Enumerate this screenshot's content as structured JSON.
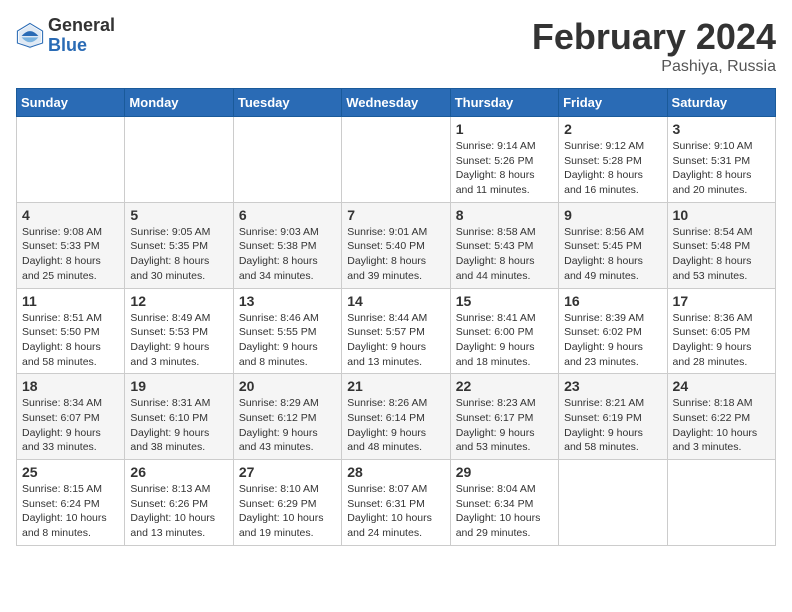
{
  "header": {
    "logo_general": "General",
    "logo_blue": "Blue",
    "title": "February 2024",
    "location": "Pashiya, Russia"
  },
  "calendar": {
    "days_of_week": [
      "Sunday",
      "Monday",
      "Tuesday",
      "Wednesday",
      "Thursday",
      "Friday",
      "Saturday"
    ],
    "weeks": [
      [
        {
          "day": "",
          "info": ""
        },
        {
          "day": "",
          "info": ""
        },
        {
          "day": "",
          "info": ""
        },
        {
          "day": "",
          "info": ""
        },
        {
          "day": "1",
          "info": "Sunrise: 9:14 AM\nSunset: 5:26 PM\nDaylight: 8 hours and 11 minutes."
        },
        {
          "day": "2",
          "info": "Sunrise: 9:12 AM\nSunset: 5:28 PM\nDaylight: 8 hours and 16 minutes."
        },
        {
          "day": "3",
          "info": "Sunrise: 9:10 AM\nSunset: 5:31 PM\nDaylight: 8 hours and 20 minutes."
        }
      ],
      [
        {
          "day": "4",
          "info": "Sunrise: 9:08 AM\nSunset: 5:33 PM\nDaylight: 8 hours and 25 minutes."
        },
        {
          "day": "5",
          "info": "Sunrise: 9:05 AM\nSunset: 5:35 PM\nDaylight: 8 hours and 30 minutes."
        },
        {
          "day": "6",
          "info": "Sunrise: 9:03 AM\nSunset: 5:38 PM\nDaylight: 8 hours and 34 minutes."
        },
        {
          "day": "7",
          "info": "Sunrise: 9:01 AM\nSunset: 5:40 PM\nDaylight: 8 hours and 39 minutes."
        },
        {
          "day": "8",
          "info": "Sunrise: 8:58 AM\nSunset: 5:43 PM\nDaylight: 8 hours and 44 minutes."
        },
        {
          "day": "9",
          "info": "Sunrise: 8:56 AM\nSunset: 5:45 PM\nDaylight: 8 hours and 49 minutes."
        },
        {
          "day": "10",
          "info": "Sunrise: 8:54 AM\nSunset: 5:48 PM\nDaylight: 8 hours and 53 minutes."
        }
      ],
      [
        {
          "day": "11",
          "info": "Sunrise: 8:51 AM\nSunset: 5:50 PM\nDaylight: 8 hours and 58 minutes."
        },
        {
          "day": "12",
          "info": "Sunrise: 8:49 AM\nSunset: 5:53 PM\nDaylight: 9 hours and 3 minutes."
        },
        {
          "day": "13",
          "info": "Sunrise: 8:46 AM\nSunset: 5:55 PM\nDaylight: 9 hours and 8 minutes."
        },
        {
          "day": "14",
          "info": "Sunrise: 8:44 AM\nSunset: 5:57 PM\nDaylight: 9 hours and 13 minutes."
        },
        {
          "day": "15",
          "info": "Sunrise: 8:41 AM\nSunset: 6:00 PM\nDaylight: 9 hours and 18 minutes."
        },
        {
          "day": "16",
          "info": "Sunrise: 8:39 AM\nSunset: 6:02 PM\nDaylight: 9 hours and 23 minutes."
        },
        {
          "day": "17",
          "info": "Sunrise: 8:36 AM\nSunset: 6:05 PM\nDaylight: 9 hours and 28 minutes."
        }
      ],
      [
        {
          "day": "18",
          "info": "Sunrise: 8:34 AM\nSunset: 6:07 PM\nDaylight: 9 hours and 33 minutes."
        },
        {
          "day": "19",
          "info": "Sunrise: 8:31 AM\nSunset: 6:10 PM\nDaylight: 9 hours and 38 minutes."
        },
        {
          "day": "20",
          "info": "Sunrise: 8:29 AM\nSunset: 6:12 PM\nDaylight: 9 hours and 43 minutes."
        },
        {
          "day": "21",
          "info": "Sunrise: 8:26 AM\nSunset: 6:14 PM\nDaylight: 9 hours and 48 minutes."
        },
        {
          "day": "22",
          "info": "Sunrise: 8:23 AM\nSunset: 6:17 PM\nDaylight: 9 hours and 53 minutes."
        },
        {
          "day": "23",
          "info": "Sunrise: 8:21 AM\nSunset: 6:19 PM\nDaylight: 9 hours and 58 minutes."
        },
        {
          "day": "24",
          "info": "Sunrise: 8:18 AM\nSunset: 6:22 PM\nDaylight: 10 hours and 3 minutes."
        }
      ],
      [
        {
          "day": "25",
          "info": "Sunrise: 8:15 AM\nSunset: 6:24 PM\nDaylight: 10 hours and 8 minutes."
        },
        {
          "day": "26",
          "info": "Sunrise: 8:13 AM\nSunset: 6:26 PM\nDaylight: 10 hours and 13 minutes."
        },
        {
          "day": "27",
          "info": "Sunrise: 8:10 AM\nSunset: 6:29 PM\nDaylight: 10 hours and 19 minutes."
        },
        {
          "day": "28",
          "info": "Sunrise: 8:07 AM\nSunset: 6:31 PM\nDaylight: 10 hours and 24 minutes."
        },
        {
          "day": "29",
          "info": "Sunrise: 8:04 AM\nSunset: 6:34 PM\nDaylight: 10 hours and 29 minutes."
        },
        {
          "day": "",
          "info": ""
        },
        {
          "day": "",
          "info": ""
        }
      ]
    ]
  }
}
